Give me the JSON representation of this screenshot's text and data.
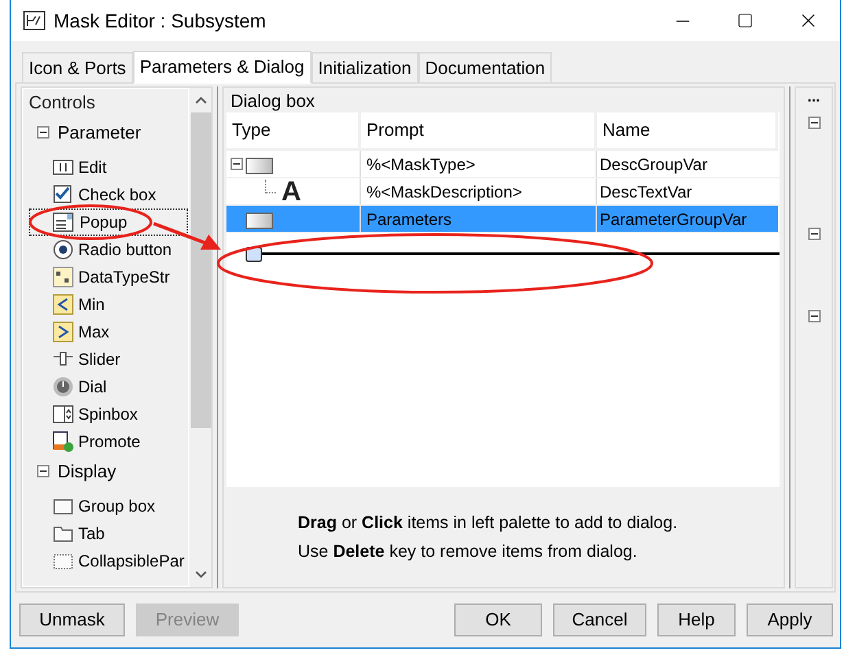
{
  "window": {
    "title": "Mask Editor : Subsystem"
  },
  "tabs": [
    {
      "label": "Icon & Ports",
      "selected": false
    },
    {
      "label": "Parameters & Dialog",
      "selected": true
    },
    {
      "label": "Initialization",
      "selected": false
    },
    {
      "label": "Documentation",
      "selected": false
    }
  ],
  "controls": {
    "title": "Controls",
    "groups": [
      {
        "label": "Parameter",
        "expanded": true,
        "items": [
          {
            "kind": "edit",
            "label": "Edit",
            "selected": false
          },
          {
            "kind": "checkbox",
            "label": "Check box",
            "selected": false
          },
          {
            "kind": "popup",
            "label": "Popup",
            "selected": true
          },
          {
            "kind": "radio",
            "label": "Radio button",
            "selected": false
          },
          {
            "kind": "datatype",
            "label": "DataTypeStr",
            "selected": false
          },
          {
            "kind": "min",
            "label": "Min",
            "selected": false
          },
          {
            "kind": "max",
            "label": "Max",
            "selected": false
          },
          {
            "kind": "slider",
            "label": "Slider",
            "selected": false
          },
          {
            "kind": "dial",
            "label": "Dial",
            "selected": false
          },
          {
            "kind": "spinbox",
            "label": "Spinbox",
            "selected": false
          },
          {
            "kind": "promote",
            "label": "Promote",
            "selected": false
          }
        ]
      },
      {
        "label": "Display",
        "expanded": true,
        "items": [
          {
            "kind": "groupbox",
            "label": "Group box",
            "selected": false
          },
          {
            "kind": "tab",
            "label": "Tab",
            "selected": false
          },
          {
            "kind": "collapsible",
            "label": "CollapsiblePar",
            "selected": false
          }
        ]
      }
    ]
  },
  "dialog_box": {
    "title": "Dialog box",
    "columns": [
      "Type",
      "Prompt",
      "Name"
    ],
    "rows": [
      {
        "kind": "group",
        "prompt": "%<MaskType>",
        "name": "DescGroupVar",
        "selected": false,
        "expanded": true,
        "children": [
          {
            "kind": "text",
            "glyph": "A",
            "prompt": "%<MaskDescription>",
            "name": "DescTextVar",
            "selected": false
          }
        ]
      },
      {
        "kind": "group",
        "prompt": "Parameters",
        "name": "ParameterGroupVar",
        "selected": true
      }
    ],
    "hint": [
      "**Drag** or **Click** items in left palette to add to dialog.",
      "Use **Delete** key to remove items from dialog."
    ]
  },
  "side_strip": {
    "label": "..."
  },
  "buttons": [
    {
      "label": "Unmask",
      "disabled": false
    },
    {
      "label": "Preview",
      "disabled": true
    }
  ],
  "dialog_buttons": [
    {
      "label": "OK",
      "disabled": false
    },
    {
      "label": "Cancel",
      "disabled": false
    },
    {
      "label": "Help",
      "disabled": false
    },
    {
      "label": "Apply",
      "disabled": false
    }
  ]
}
